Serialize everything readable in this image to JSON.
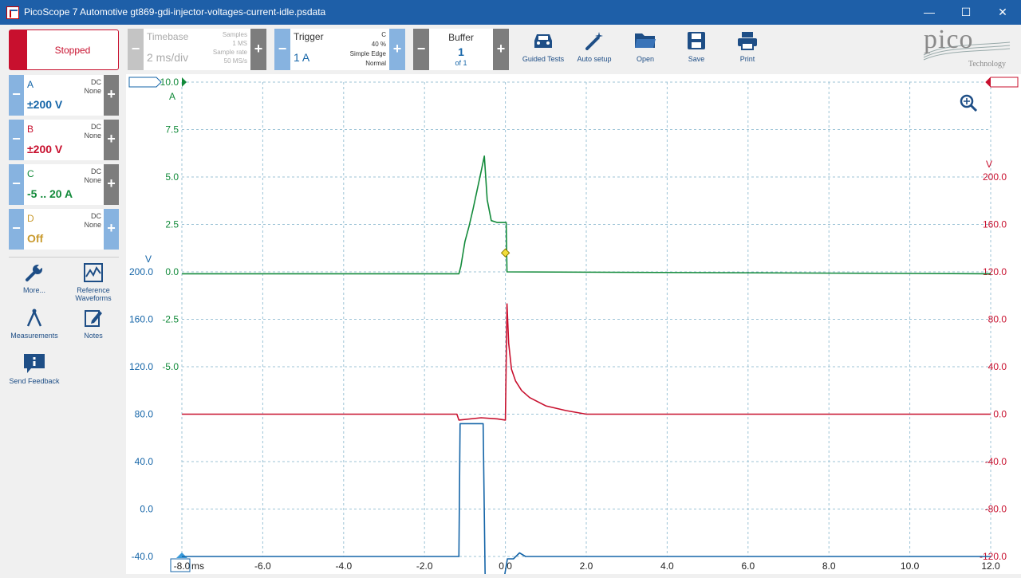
{
  "window": {
    "title": "PicoScope 7 Automotive gt869-gdi-injector-voltages-current-idle.psdata",
    "minimize": "—",
    "maximize": "☐",
    "close": "✕"
  },
  "run_button": {
    "label": "Stopped"
  },
  "channels": [
    {
      "name": "A",
      "coupling": "DC",
      "probe": "None",
      "range": "±200 V",
      "color": "#1565a8"
    },
    {
      "name": "B",
      "coupling": "DC",
      "probe": "None",
      "range": "±200 V",
      "color": "#c8102e"
    },
    {
      "name": "C",
      "coupling": "DC",
      "probe": "None",
      "range": "-5 .. 20 A",
      "color": "#128a3a"
    },
    {
      "name": "D",
      "coupling": "DC",
      "probe": "None",
      "range": "Off",
      "color": "#c99a2e"
    }
  ],
  "tools": {
    "more": "More...",
    "reference_line1": "Reference",
    "reference_line2": "Waveforms",
    "measurements": "Measurements",
    "notes": "Notes",
    "feedback": "Send Feedback"
  },
  "timebase": {
    "label": "Timebase",
    "value": "2 ms/div",
    "samples_label": "Samples",
    "samples_value": "1 MS",
    "rate_label": "Sample rate",
    "rate_value": "50 MS/s"
  },
  "trigger": {
    "label": "Trigger",
    "value": "1 A",
    "channel": "C",
    "position": "40 %",
    "type": "Simple Edge",
    "mode": "Normal"
  },
  "buffer": {
    "label": "Buffer",
    "value": "1",
    "of": "of 1"
  },
  "toolbar_buttons": {
    "guided": "Guided Tests",
    "auto": "Auto setup",
    "open": "Open",
    "save": "Save",
    "print": "Print"
  },
  "logo": {
    "text": "pico",
    "sub": "Technology"
  },
  "chart_data": {
    "type": "line",
    "xlabel_unit": "ms",
    "xlim": [
      -8,
      12
    ],
    "x_ticks": [
      "-8.0",
      "-6.0",
      "-4.0",
      "-2.0",
      "0.0",
      "2.0",
      "4.0",
      "6.0",
      "8.0",
      "10.0",
      "12.0"
    ],
    "y_axes": [
      {
        "channel": "C",
        "unit": "A",
        "range": [
          -5,
          20
        ],
        "ticks": [
          "10.0",
          "7.5",
          "5.0",
          "2.5",
          "0.0",
          "-2.5",
          "-5.0"
        ],
        "color": "#128a3a"
      },
      {
        "channel": "A",
        "unit": "V",
        "range": [
          -200,
          200
        ],
        "ticks": [
          "200.0",
          "160.0",
          "120.0",
          "80.0",
          "40.0",
          "0.0",
          "-40.0"
        ],
        "color": "#1565a8"
      },
      {
        "channel": "B",
        "unit": "V",
        "range": [
          -200,
          200
        ],
        "ticks": [
          "200.0",
          "160.0",
          "120.0",
          "80.0",
          "40.0",
          "0.0",
          "-40.0",
          "-80.0",
          "-120.0"
        ],
        "color": "#c8102e"
      }
    ],
    "trigger_marker": {
      "x": 0.0,
      "y": 1.0
    },
    "series": [
      {
        "channel": "C",
        "color": "#128a3a",
        "x": [
          -8,
          -1.15,
          -1.1,
          -1.0,
          -0.9,
          -0.8,
          -0.7,
          -0.6,
          -0.52,
          -0.45,
          -0.35,
          -0.2,
          -0.05,
          0.02,
          0.04,
          12
        ],
        "y": [
          -0.1,
          -0.1,
          0.3,
          1.6,
          2.4,
          3.3,
          4.3,
          5.3,
          6.1,
          3.8,
          2.7,
          2.6,
          2.6,
          2.6,
          0.0,
          -0.1
        ]
      },
      {
        "channel": "B",
        "color": "#c8102e",
        "x": [
          -8,
          -1.2,
          -1.15,
          -0.6,
          -0.2,
          0.0,
          0.04,
          0.08,
          0.15,
          0.25,
          0.4,
          0.6,
          1.0,
          1.5,
          2.0,
          12
        ],
        "y": [
          0,
          0,
          -5,
          -3,
          -4,
          -5,
          93,
          60,
          38,
          28,
          20,
          14,
          7,
          3,
          0,
          0
        ]
      },
      {
        "channel": "A",
        "color": "#1565a8",
        "x": [
          -8,
          -1.15,
          -1.12,
          -0.55,
          -0.5,
          -0.05,
          0.05,
          0.2,
          0.35,
          0.5,
          12
        ],
        "y": [
          -40,
          -40,
          72,
          72,
          -62,
          -62,
          -42,
          -42,
          -37,
          -40,
          -40
        ]
      }
    ]
  }
}
